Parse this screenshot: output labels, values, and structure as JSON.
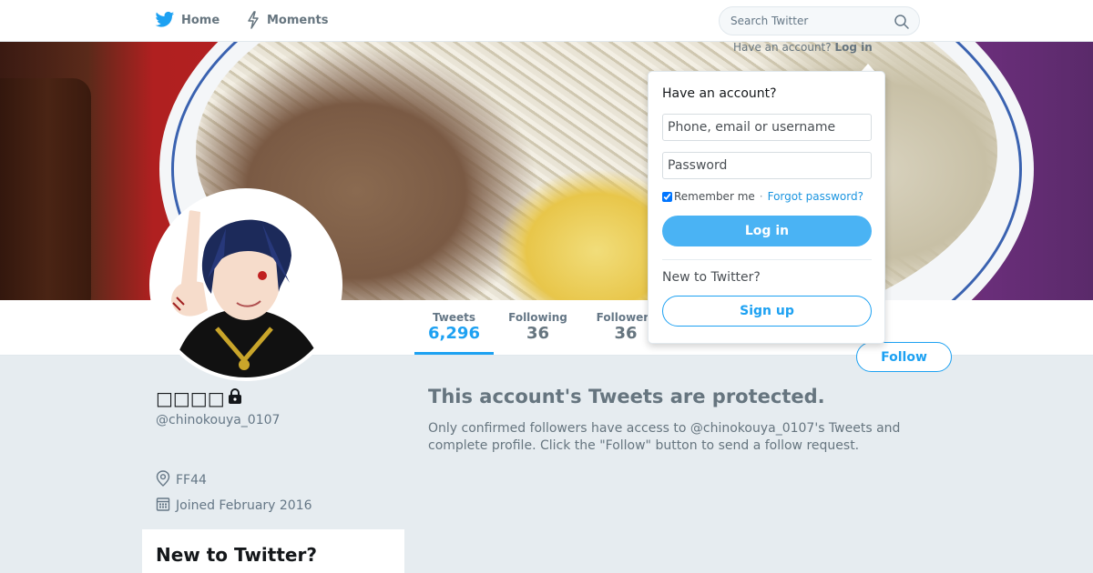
{
  "nav": {
    "home_label": "Home",
    "moments_label": "Moments",
    "search_placeholder": "Search Twitter",
    "login_hint_prefix": "Have an account?",
    "login_hint_link": "Log in"
  },
  "profile": {
    "display_name": "□□□□",
    "screen_name": "@chinokouya_0107",
    "location": "FF44",
    "joined": "Joined February 2016",
    "protected": true
  },
  "stats": [
    {
      "label": "Tweets",
      "value": "6,296"
    },
    {
      "label": "Following",
      "value": "36"
    },
    {
      "label": "Followers",
      "value": "36"
    }
  ],
  "follow_label": "Follow",
  "protected": {
    "title": "This account's Tweets are protected.",
    "body": "Only confirmed followers have access to @chinokouya_0107's Tweets and complete profile. Click the \"Follow\" button to send a follow request."
  },
  "sidebar_card": {
    "title": "New to Twitter?"
  },
  "login_dropdown": {
    "title": "Have an account?",
    "username_placeholder": "Phone, email or username",
    "password_placeholder": "Password",
    "remember_label": "Remember me",
    "separator": "·",
    "forgot_label": "Forgot password?",
    "login_label": "Log in",
    "new_label": "New to Twitter?",
    "signup_label": "Sign up",
    "remember_checked": true
  },
  "colors": {
    "accent": "#1da1f2",
    "login_button": "#4ab3f4",
    "background": "#e6ecf0",
    "muted_text": "#657786"
  }
}
